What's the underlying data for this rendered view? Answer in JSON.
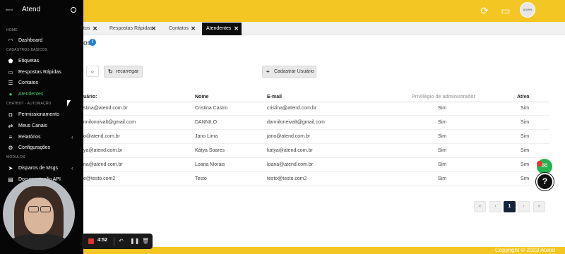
{
  "brand": {
    "logo_small": "atend",
    "name": "Atend"
  },
  "sidebar": {
    "sections": {
      "home": "HOME",
      "basic": "CADASTROS BÁSICOS",
      "chatbot": "CHATBOT - AUTOMAÇÃO",
      "modules": "MÓDULOS"
    },
    "items": [
      {
        "label": "Dashboard"
      },
      {
        "label": "Etiquetas"
      },
      {
        "label": "Respostas Rápidas"
      },
      {
        "label": "Contatos"
      },
      {
        "label": "Atendentes"
      },
      {
        "label": "Permissionamento"
      },
      {
        "label": "Meus Canais"
      },
      {
        "label": "Relatórios"
      },
      {
        "label": "Configurações"
      },
      {
        "label": "Disparos de Msgs"
      },
      {
        "label": "Documentação API"
      }
    ]
  },
  "header": {
    "avatar_text": "ADMIN"
  },
  "tabs": [
    {
      "label": "tos"
    },
    {
      "label": "Respostas Rápidas"
    },
    {
      "label": "Contatos"
    },
    {
      "label": "Atendentes"
    }
  ],
  "main": {
    "page_title_fragment": "os",
    "refresh_label": "recarregar",
    "add_label": "Cadastrar Usuário",
    "columns": [
      "uário:",
      "Nome",
      "E-mail",
      "Privilégio de administrador",
      "Ativo"
    ],
    "rows": [
      {
        "user": "stina@atend.com.br",
        "name": "Cristina Castro",
        "email": "cristina@atend.com.br",
        "admin": "Sim",
        "active": "Sim"
      },
      {
        "user": "nnilonoivalt@gmail.com",
        "name": "DANNILO",
        "email": "danniloneivalt@gmail.com",
        "admin": "Sim",
        "active": "Sim"
      },
      {
        "user": "o@atend.com.br",
        "name": "Jano Lima",
        "email": "jano@atend.com.br",
        "admin": "Sim",
        "active": "Sim"
      },
      {
        "user": "ya@atend.com.br",
        "name": "Kátya Soares",
        "email": "katya@atend.com.br",
        "admin": "Sim",
        "active": "Sim"
      },
      {
        "user": "na@atend.com.br",
        "name": "Loana Morais",
        "email": "loana@atend.com.br",
        "admin": "Sim",
        "active": "Sim"
      },
      {
        "user": "e@testo.com2",
        "name": "Testo",
        "email": "testo@testo.com2",
        "admin": "Sim",
        "active": "Sim"
      }
    ],
    "pagination": {
      "first": "«",
      "prev": "‹",
      "current": "1",
      "next": "›",
      "last": "»"
    }
  },
  "footer": {
    "copyright": "Copyright © 2023 Atend"
  },
  "recorder": {
    "time": "4:52"
  },
  "colors": {
    "accent": "#f3c623",
    "sidebar": "#060606",
    "active_item": "#43c56e",
    "chat": "#28b24f"
  }
}
